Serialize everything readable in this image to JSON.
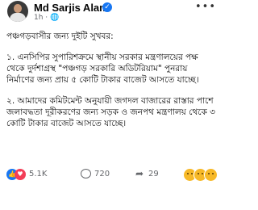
{
  "author": {
    "name": "Md Sarjis Alam",
    "meta": "1h · 🌐"
  },
  "post": {
    "title": "পঞ্চগড়বাসীর জন্য দুইটি সুখবর:",
    "paragraphs": [
      "১. এনসিপির সুপারিশক্রমে স্থানীয় সরকার মন্ত্রণালয়ের পক্ষ থেকে দুর্দশাগ্রস্থ \"পঞ্চগড় সরকারি অডিটরিয়াম\" পুনরায় নির্মাণের জন্য প্রায় ৫ কোটি টাকার বাজেট আসতে যাচ্ছে।",
      "২. আমাদের কমিটমেন্ট অনুযায়ী জগদল বাজারের রাস্তার পাশে জলাবদ্ধতা দূরীকরণের জন্য সড়ক ও জনপথ মন্ত্রণালয় থেকে ৩ কোটি টাকার বাজেট আসতে যাচ্ছে।"
    ]
  },
  "engagement": {
    "reactions": "5.1K",
    "comments": "720",
    "shares": "29"
  },
  "icons": [
    "more-icon",
    "verified-badge-icon",
    "like-icon",
    "love-icon",
    "comment-icon",
    "share-icon",
    "haha-icon"
  ]
}
